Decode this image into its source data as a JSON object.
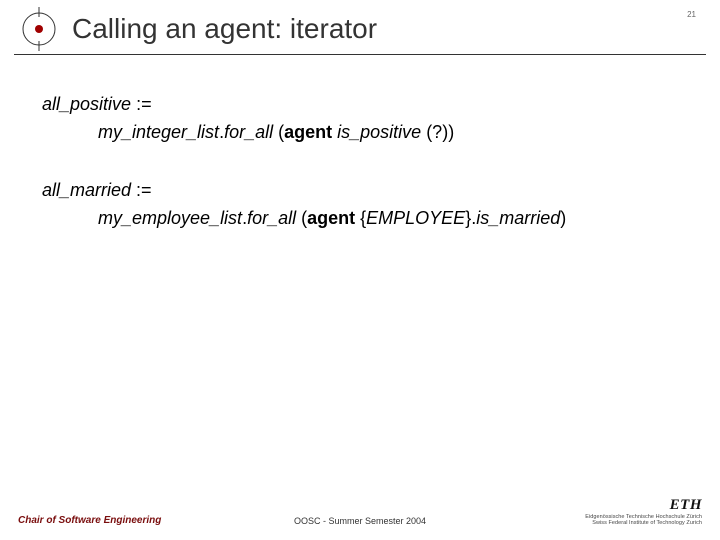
{
  "header": {
    "title": "Calling an agent: iterator",
    "page_number": "21"
  },
  "body": {
    "line1": {
      "var": "all_positive",
      "assign": " :="
    },
    "line2": {
      "obj": "my_integer_list",
      "dot1": ".",
      "call": "for_all ",
      "open": "(",
      "agent": "agent",
      "sp1": " ",
      "pred": "is_positive",
      "arg": " (?",
      "close": "))"
    },
    "line3": {
      "var": "all_married",
      "assign": " :="
    },
    "line4": {
      "obj": "my_employee_list",
      "dot1": ".",
      "call": "for_all ",
      "open": "(",
      "agent": "agent",
      "sp1": " {",
      "type": "EMPLOYEE",
      "brace": "}.",
      "pred": "is_married",
      "close": ")"
    }
  },
  "footer": {
    "left": "Chair of Software Engineering",
    "center": "OOSC - Summer Semester 2004",
    "right": {
      "logo": "ETH",
      "sub1": "Eidgenössische Technische Hochschule Zürich",
      "sub2": "Swiss Federal Institute of Technology Zurich"
    }
  }
}
